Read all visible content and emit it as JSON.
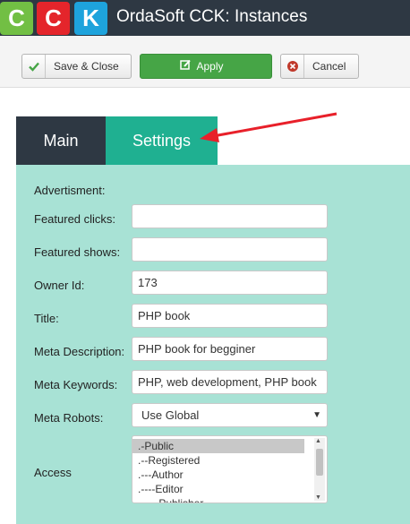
{
  "header": {
    "logo_letters": [
      "C",
      "C",
      "K"
    ],
    "logo_colors": [
      "#72bf44",
      "#e4252b",
      "#1ea3dc"
    ],
    "title": "OrdaSoft CCK: Instances"
  },
  "toolbar": {
    "save_close_label": "Save & Close",
    "apply_label": "Apply",
    "cancel_label": "Cancel",
    "apply_color": "#46a546"
  },
  "tabs": [
    {
      "label": "Main",
      "active": false
    },
    {
      "label": "Settings",
      "active": true
    }
  ],
  "form": {
    "section_label": "Advertisment:",
    "featured_clicks": {
      "label": "Featured clicks:",
      "value": ""
    },
    "featured_shows": {
      "label": "Featured shows:",
      "value": ""
    },
    "owner_id": {
      "label": "Owner Id:",
      "value": "173"
    },
    "title": {
      "label": "Title:",
      "value": "PHP book"
    },
    "meta_description": {
      "label": "Meta Description:",
      "value": "PHP book for begginer"
    },
    "meta_keywords": {
      "label": "Meta Keywords:",
      "value": "PHP, web development, PHP book"
    },
    "meta_robots": {
      "label": "Meta Robots:",
      "value": "Use Global"
    },
    "access": {
      "label": "Access",
      "options": [
        ".-Public",
        ".--Registered",
        ".---Author",
        ".----Editor",
        ".-----Publisher"
      ],
      "selected_index": 0
    }
  },
  "colors": {
    "header_bg": "#2e3843",
    "settings_tab": "#1fb091",
    "panel_bg": "#a8e2d5",
    "arrow": "#e8202a"
  }
}
